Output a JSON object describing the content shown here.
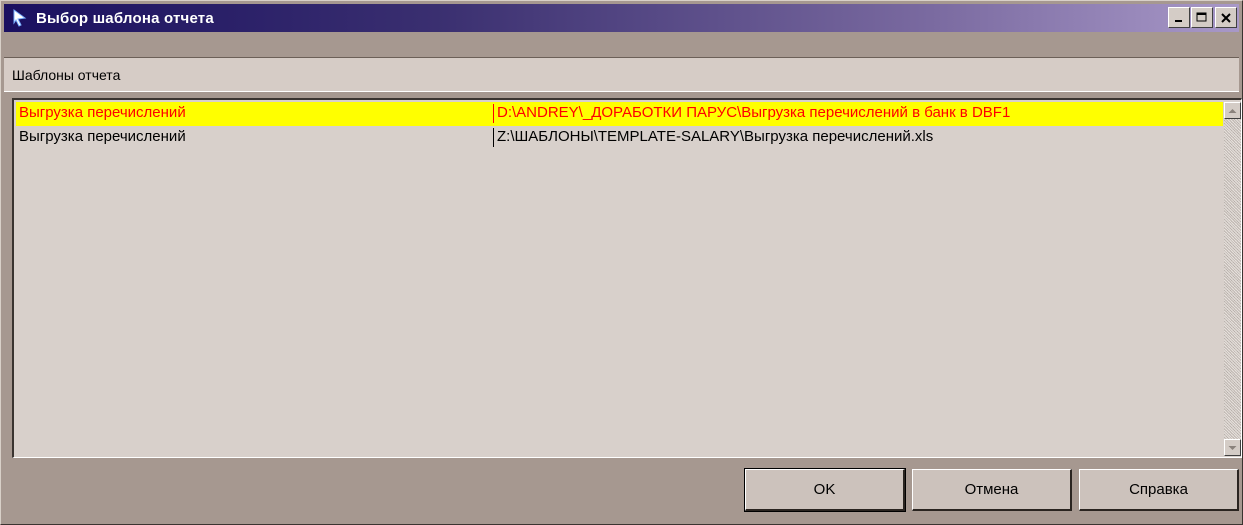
{
  "window": {
    "title": "Выбор шаблона отчета",
    "icon": "report-icon",
    "controls": {
      "minimize_icon": "minimize-icon",
      "maximize_icon": "maximize-icon",
      "close_icon": "close-icon"
    }
  },
  "group": {
    "label": "Шаблоны отчета"
  },
  "templates": [
    {
      "name": "Выгрузка перечислений",
      "path": "D:\\ANDREY\\_ДОРАБОТКИ ПАРУС\\Выгрузка перечислений в банк в DBF1",
      "selected": true
    },
    {
      "name": "Выгрузка перечислений",
      "path": "Z:\\ШАБЛОНЫ\\TEMPLATE-SALARY\\Выгрузка перечислений.xls",
      "selected": false
    }
  ],
  "buttons": {
    "ok": "OK",
    "cancel": "Отмена",
    "help": "Справка"
  },
  "colors": {
    "selected_bg": "#ffff00",
    "selected_text": "#ff0000",
    "title_gradient_start": "#1a1060",
    "title_gradient_end": "#a898c8"
  }
}
